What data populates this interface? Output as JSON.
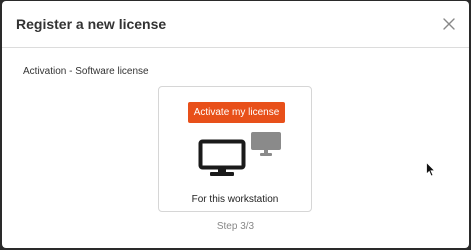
{
  "dialog": {
    "title": "Register a new license",
    "close_icon": "close-icon"
  },
  "subtitle": "Activation - Software license",
  "option_card": {
    "button_label": "Activate my license",
    "label": "For this workstation",
    "icons": [
      "monitor-icon",
      "small-monitor-icon"
    ]
  },
  "step": "Step 3/3",
  "colors": {
    "accent": "#e8501a",
    "backdrop": "#2a2a2a"
  }
}
